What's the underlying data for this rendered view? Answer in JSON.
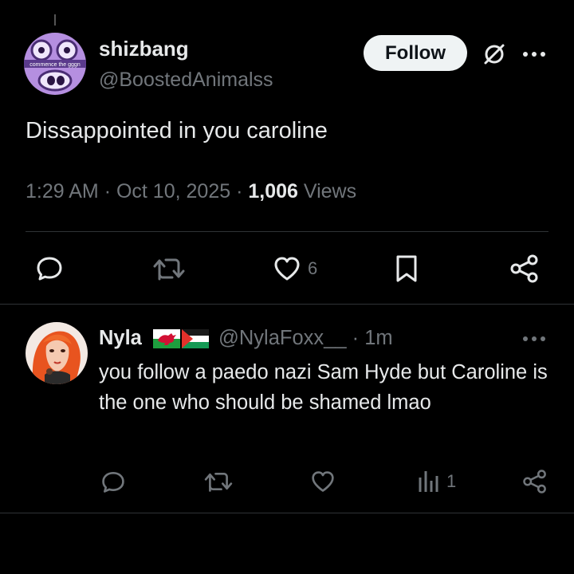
{
  "tweet": {
    "author_name": "shizbang",
    "author_handle": "@BoostedAnimalss",
    "avatar_caption": "commence the gggn",
    "follow_label": "Follow",
    "text": "Dissappointed in you caroline",
    "time": "1:29 AM",
    "sep": "·",
    "date": "Oct 10, 2025",
    "views_count": "1,006",
    "views_label": "Views",
    "likes_count": "6"
  },
  "reply": {
    "author_name": "Nyla",
    "author_handle": "@NylaFoxx__",
    "sep": "·",
    "time_ago": "1m",
    "text": "you follow a paedo nazi Sam Hyde but Caroline is the one who should be shamed lmao",
    "views_count": "1"
  },
  "icons": {
    "grok": "grok-icon",
    "more": "more-dots-icon",
    "reply": "reply-bubble-icon",
    "retweet": "retweet-icon",
    "like": "heart-icon",
    "bookmark": "bookmark-icon",
    "share": "share-icon",
    "analytics": "analytics-icon",
    "flags": [
      "wales-flag",
      "palestine-flag"
    ]
  },
  "colors": {
    "background": "#000000",
    "text": "#e7e9ea",
    "secondary": "#71767b",
    "divider": "#2f3336",
    "follow_bg": "#eff3f4"
  }
}
